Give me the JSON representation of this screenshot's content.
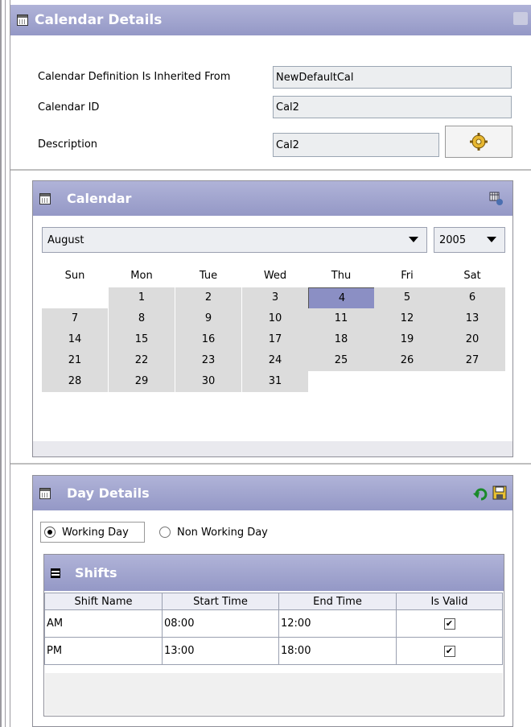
{
  "details": {
    "title": "Calendar Details",
    "inherited_label": "Calendar Definition Is Inherited From",
    "inherited_value": "NewDefaultCal",
    "id_label": "Calendar ID",
    "id_value": "Cal2",
    "desc_label": "Description",
    "desc_value": "Cal2"
  },
  "calendar": {
    "title": "Calendar",
    "month": "August",
    "year": "2005",
    "weekdays": [
      "Sun",
      "Mon",
      "Tue",
      "Wed",
      "Thu",
      "Fri",
      "Sat"
    ],
    "weeks": [
      [
        "",
        "1",
        "2",
        "3",
        "4",
        "5",
        "6"
      ],
      [
        "7",
        "8",
        "9",
        "10",
        "11",
        "12",
        "13"
      ],
      [
        "14",
        "15",
        "16",
        "17",
        "18",
        "19",
        "20"
      ],
      [
        "21",
        "22",
        "23",
        "24",
        "25",
        "26",
        "27"
      ],
      [
        "28",
        "29",
        "30",
        "31",
        "",
        "",
        ""
      ]
    ],
    "selected_day": "4"
  },
  "day_details": {
    "title": "Day Details",
    "working_label": "Working Day",
    "non_working_label": "Non Working Day",
    "selected": "working"
  },
  "shifts": {
    "title": "Shifts",
    "columns": [
      "Shift Name",
      "Start Time",
      "End Time",
      "Is Valid"
    ],
    "rows": [
      {
        "name": "AM",
        "start": "08:00",
        "end": "12:00",
        "valid": true
      },
      {
        "name": "PM",
        "start": "13:00",
        "end": "18:00",
        "valid": true
      }
    ]
  }
}
